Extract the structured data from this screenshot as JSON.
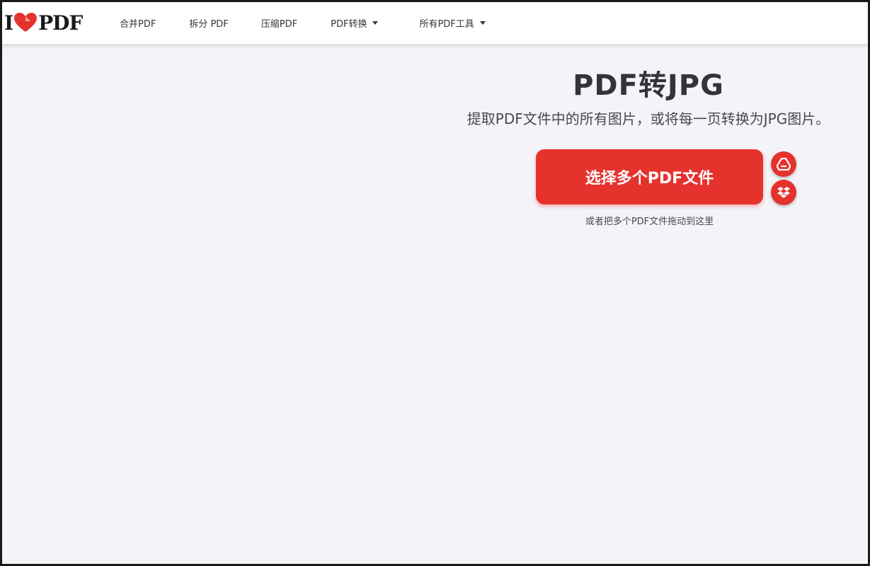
{
  "logo": {
    "left": "I",
    "right": "PDF",
    "heart_color": "#e5322d"
  },
  "nav": {
    "items": [
      {
        "label": "合并PDF",
        "dropdown": false
      },
      {
        "label": "拆分 PDF",
        "dropdown": false
      },
      {
        "label": "压缩PDF",
        "dropdown": false
      },
      {
        "label": "PDF转换",
        "dropdown": true
      },
      {
        "label": "所有PDF工具",
        "dropdown": true
      }
    ]
  },
  "main": {
    "title": "PDF转JPG",
    "subtitle": "提取PDF文件中的所有图片，或将每一页转换为JPG图片。",
    "select_button_label": "选择多个PDF文件",
    "drop_hint": "或者把多个PDF文件拖动到这里",
    "cloud_buttons": [
      {
        "icon": "google-drive-icon"
      },
      {
        "icon": "dropbox-icon"
      }
    ]
  },
  "colors": {
    "accent": "#e5322d",
    "background": "#f4f4f8",
    "text": "#33333b"
  }
}
